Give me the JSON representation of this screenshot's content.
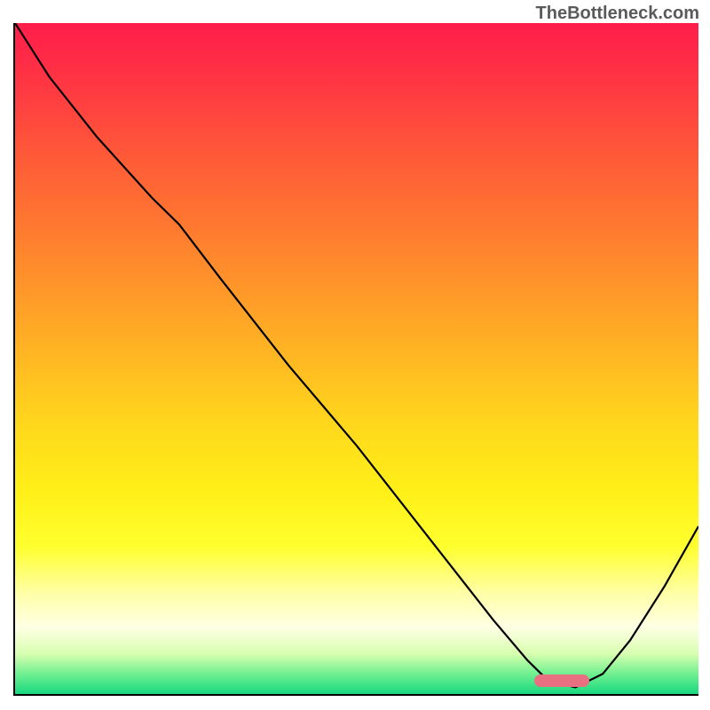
{
  "watermark": "TheBottleneck.com",
  "chart_data": {
    "type": "line",
    "title": "",
    "xlabel": "",
    "ylabel": "",
    "xlim": [
      0,
      100
    ],
    "ylim": [
      0,
      100
    ],
    "grid": false,
    "background": "heatmap-gradient-vertical",
    "gradient_stops": [
      {
        "pos": 0,
        "color": "#ff1e4a"
      },
      {
        "pos": 50,
        "color": "#ffc020"
      },
      {
        "pos": 80,
        "color": "#ffff40"
      },
      {
        "pos": 100,
        "color": "#18d880"
      }
    ],
    "series": [
      {
        "name": "bottleneck-curve",
        "color": "#000000",
        "x": [
          0,
          5,
          12,
          20,
          24,
          30,
          40,
          50,
          60,
          70,
          75,
          78,
          82,
          86,
          90,
          95,
          100
        ],
        "y": [
          100,
          92,
          83,
          74,
          70,
          62,
          49,
          37,
          24,
          11,
          5,
          2,
          1,
          3,
          8,
          16,
          25
        ]
      }
    ],
    "annotations": [
      {
        "type": "marker-pill",
        "name": "optimal-range",
        "x_center": 80,
        "y": 2,
        "width": 8,
        "color": "#e87080"
      }
    ]
  }
}
